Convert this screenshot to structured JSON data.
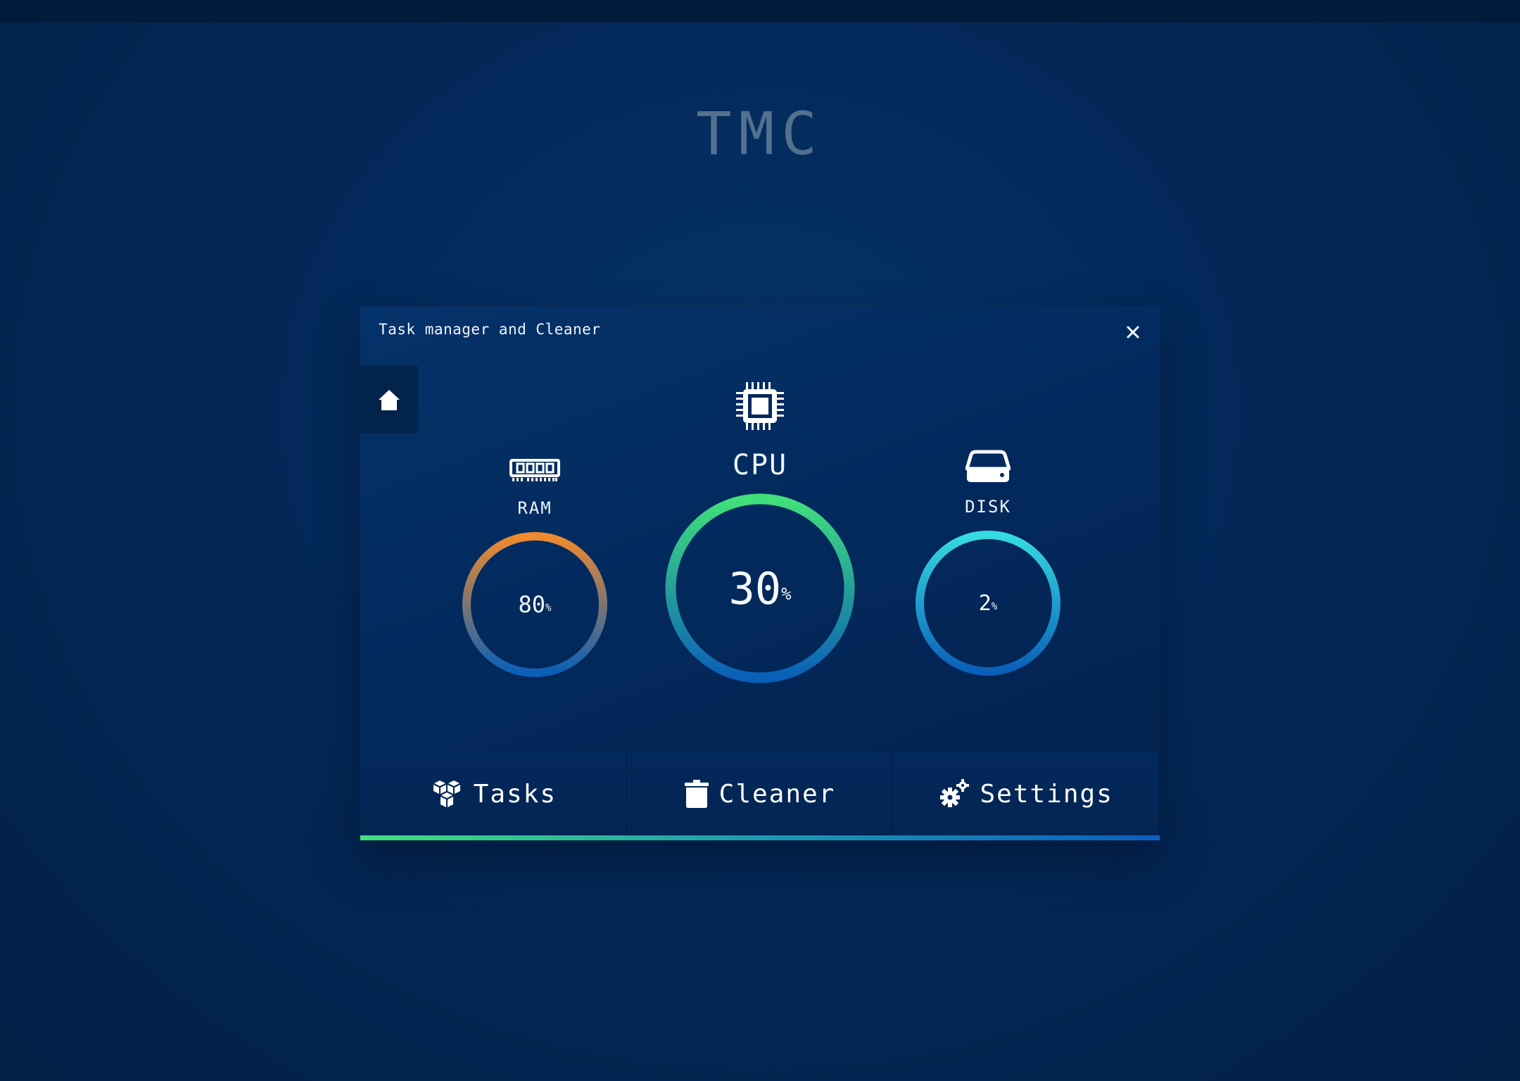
{
  "brand": "TMC",
  "window": {
    "title": "Task manager and Cleaner",
    "close_label": "×"
  },
  "metrics": {
    "ram": {
      "label": "RAM",
      "value": "80",
      "unit": "%",
      "percent": 80,
      "icon": "ram-icon",
      "gradient": [
        "#f08a2e",
        "#0a5fb8"
      ]
    },
    "cpu": {
      "label": "CPU",
      "value": "30",
      "unit": "%",
      "percent": 30,
      "icon": "cpu-chip-icon",
      "gradient": [
        "#41e07a",
        "#0a5fb8"
      ]
    },
    "disk": {
      "label": "DISK",
      "value": "2",
      "unit": "%",
      "percent": 2,
      "icon": "disk-drive-icon",
      "gradient": [
        "#36dbe0",
        "#0a5fb8"
      ]
    }
  },
  "nav": [
    {
      "label": "Tasks",
      "icon": "cubes-icon"
    },
    {
      "label": "Cleaner",
      "icon": "trash-icon"
    },
    {
      "label": "Settings",
      "icon": "gears-icon"
    }
  ],
  "colors": {
    "background": "#03295a",
    "accent_green": "#41e07a",
    "accent_blue": "#0b5fbf",
    "brand_text": "#52708f"
  }
}
